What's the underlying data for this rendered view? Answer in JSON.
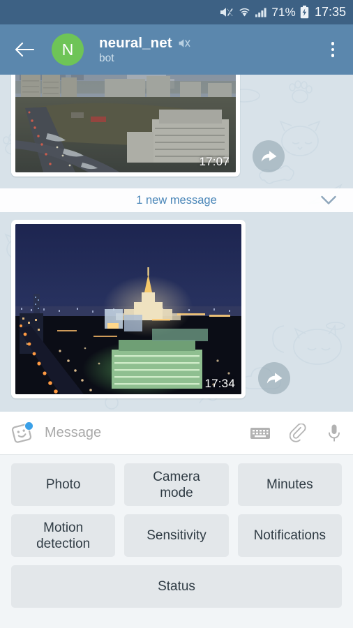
{
  "statusbar": {
    "icons": [
      "mute-icon",
      "wifi-icon",
      "signal-icon"
    ],
    "battery_percent": "71%",
    "battery_state": "charging",
    "clock": "17:35"
  },
  "header": {
    "back_icon": "back-arrow-icon",
    "avatar_letter": "N",
    "avatar_color": "#6ec457",
    "title": "neural_net",
    "mute_icon": "muted-speaker-icon",
    "subtitle": "bot",
    "menu_icon": "overflow-menu-icon",
    "bg_color": "#5b87ad"
  },
  "chat": {
    "background_color": "#d8e2e9",
    "pattern": "telegram-cat-doodles",
    "messages": [
      {
        "type": "photo",
        "caption_time": "17:07",
        "scene": "daytime city skyline with highway and buildings",
        "forward_icon": "forward-arrow-icon"
      },
      {
        "type": "photo",
        "caption_time": "17:34",
        "scene": "night city skyline with illuminated tower",
        "forward_icon": "forward-arrow-icon"
      }
    ],
    "unread_divider": {
      "label": "1 new message",
      "chevron_icon": "chevron-down-icon",
      "color": "#4a86b8"
    }
  },
  "input_bar": {
    "sticker_icon": "sticker-smiley-icon",
    "sticker_badge": true,
    "placeholder": "Message",
    "value": "",
    "icons": [
      "keyboard-icon",
      "paperclip-icon",
      "microphone-icon"
    ]
  },
  "keyboard": {
    "background_color": "#f2f5f7",
    "key_color": "#e3e7ea",
    "rows": [
      [
        {
          "label": "Photo"
        },
        {
          "label": "Camera\nmode"
        },
        {
          "label": "Minutes"
        }
      ],
      [
        {
          "label": "Motion\ndetection"
        },
        {
          "label": "Sensitivity"
        },
        {
          "label": "Notifications"
        }
      ],
      [
        {
          "label": "Status"
        }
      ]
    ]
  }
}
